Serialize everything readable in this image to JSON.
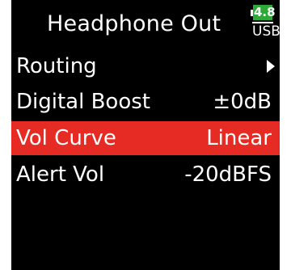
{
  "screen": {
    "title": "Headphone Out",
    "battery": {
      "voltage": "4.8",
      "type": "USB",
      "icon": "battery-icon"
    }
  },
  "menu": {
    "items": [
      {
        "label": "Routing",
        "value": "",
        "has_submenu": true,
        "selected": false
      },
      {
        "label": "Digital Boost",
        "value": "±0dB",
        "has_submenu": false,
        "selected": false
      },
      {
        "label": "Vol Curve",
        "value": "Linear",
        "has_submenu": false,
        "selected": true
      },
      {
        "label": "Alert Vol",
        "value": "-20dBFS",
        "has_submenu": false,
        "selected": false
      }
    ]
  },
  "colors": {
    "background": "#000000",
    "text": "#ffffff",
    "selection": "#e62b24",
    "battery": "#2fa83a"
  }
}
